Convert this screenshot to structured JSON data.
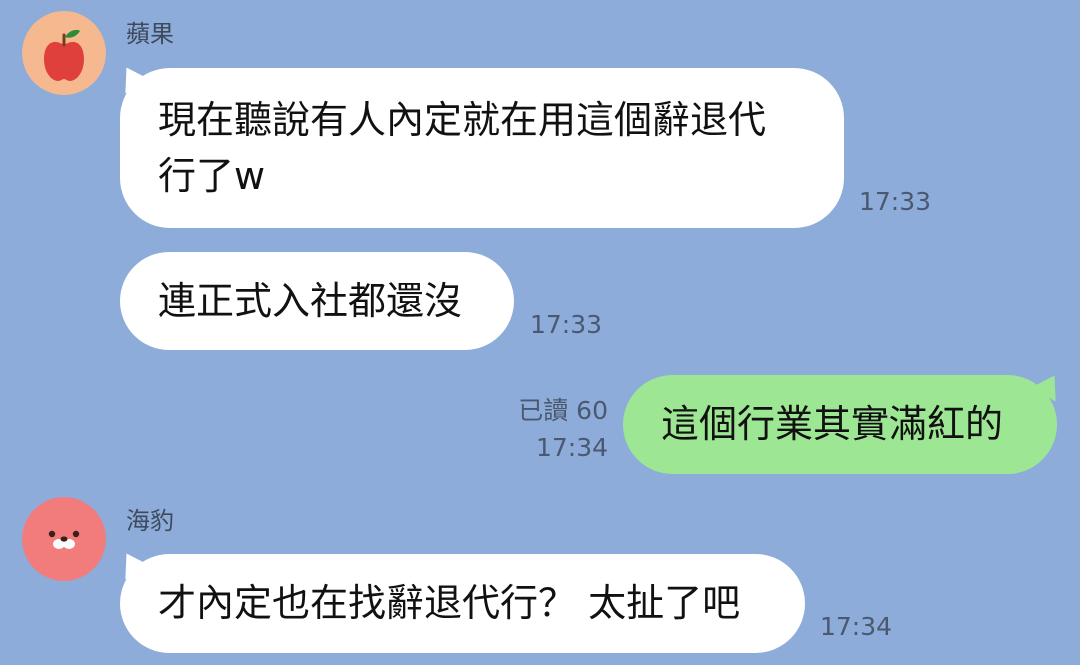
{
  "messages": [
    {
      "sender": "蘋果",
      "avatar_icon": "apple-icon",
      "text": "現在聽說有人內定就在用這個辭退代\n行了w",
      "time": "17:33"
    },
    {
      "sender": "蘋果",
      "text": "連正式入社都還沒",
      "time": "17:33"
    },
    {
      "sender": "me",
      "text": "這個行業其實滿紅的",
      "read_status": "已讀 60",
      "time": "17:34"
    },
    {
      "sender": "海豹",
      "avatar_icon": "seal-face-icon",
      "text": "才內定也在找辭退代行？ 太扯了吧",
      "time": "17:34"
    }
  ],
  "colors": {
    "background": "#8eacd9",
    "incoming_bubble": "#ffffff",
    "outgoing_bubble": "#9de693",
    "apple_avatar_bg": "#f6b98f",
    "apple_red": "#e0403b",
    "apple_leaf": "#2e8b3a",
    "seal_avatar_bg": "#f27c7c"
  }
}
